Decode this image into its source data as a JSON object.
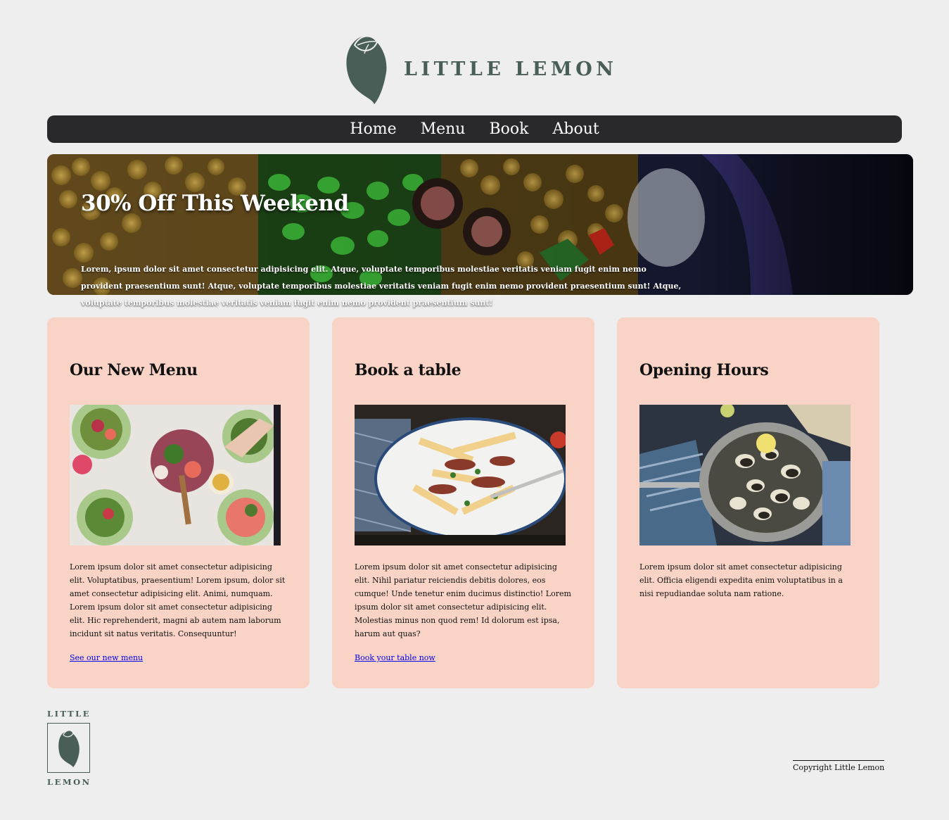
{
  "brand": {
    "name": "LITTLE LEMON",
    "footer_top": "LITTLE",
    "footer_bottom": "LEMON",
    "color": "#495e57"
  },
  "nav": {
    "items": [
      "Home",
      "Menu",
      "Book",
      "About"
    ]
  },
  "hero": {
    "title": "30% Off This Weekend",
    "text": "Lorem, ipsum dolor sit amet consectetur adipisicing elit. Atque, voluptate temporibus molestiae veritatis veniam fugit enim nemo provident praesentium sunt! Atque, voluptate temporibus molestiae veritatis veniam fugit enim nemo provident praesentium sunt! Atque, voluptate temporibus molestiae veritatis veniam fugit enim nemo provident praesentium sunt!"
  },
  "cards": [
    {
      "title": "Our New Menu",
      "text": "Lorem ipsum dolor sit amet consectetur adipisicing elit. Voluptatibus, praesentium! Lorem ipsum, dolor sit amet consectetur adipisicing elit. Animi, numquam. Lorem ipsum dolor sit amet consectetur adipisicing elit. Hic reprehenderit, magni ab autem nam laborum incidunt sit natus veritatis. Consequuntur!",
      "link": "See our new menu"
    },
    {
      "title": "Book a table",
      "text": "Lorem ipsum dolor sit amet consectetur adipisicing elit. Nihil pariatur reiciendis debitis dolores, eos cumque! Unde tenetur enim ducimus distinctio! Lorem ipsum dolor sit amet consectetur adipisicing elit. Molestias minus non quod rem! Id dolorum est ipsa, harum aut quas?",
      "link": "Book your table now"
    },
    {
      "title": "Opening Hours",
      "text": "Lorem ipsum dolor sit amet consectetur adipisicing elit. Officia eligendi expedita enim voluptatibus in a nisi repudiandae soluta nam ratione."
    }
  ],
  "footer": {
    "copyright": "Copyright Little Lemon"
  },
  "colors": {
    "background": "#edeeed",
    "nav": "#29292b",
    "card": "#f9d3c6",
    "link": "#0000ee"
  }
}
